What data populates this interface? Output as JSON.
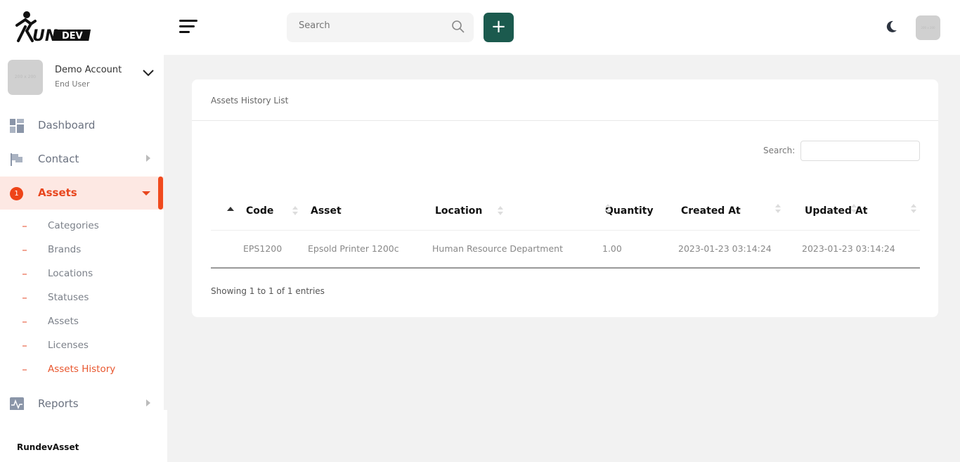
{
  "header": {
    "logo_text": "RUNDEV",
    "search_placeholder": "Search",
    "add_label": "+"
  },
  "account": {
    "name": "Demo Account",
    "role": "End User"
  },
  "sidebar": {
    "items": [
      {
        "label": "Dashboard"
      },
      {
        "label": "Contact"
      },
      {
        "label": "Assets",
        "badge": "1"
      },
      {
        "label": "Reports"
      }
    ],
    "assets_sub": [
      {
        "label": "Categories"
      },
      {
        "label": "Brands"
      },
      {
        "label": "Locations"
      },
      {
        "label": "Statuses"
      },
      {
        "label": "Assets"
      },
      {
        "label": "Licenses"
      },
      {
        "label": "Assets History"
      }
    ],
    "brand": "RundevAsset"
  },
  "colors": {
    "accent": "#e8461e",
    "add_button": "#1b5a4e"
  },
  "card": {
    "title": "Assets History List",
    "search_label": "Search:",
    "columns": [
      "Code",
      "Asset",
      "Location",
      "Quantity",
      "Created At",
      "Updated At"
    ],
    "rows": [
      [
        "EPS1200",
        "Epsold Printer 1200c",
        "Human Resource Department",
        "1.00",
        "2023-01-23 03:14:24",
        "2023-01-23 03:14:24"
      ]
    ],
    "info": "Showing 1 to 1 of 1 entries"
  }
}
